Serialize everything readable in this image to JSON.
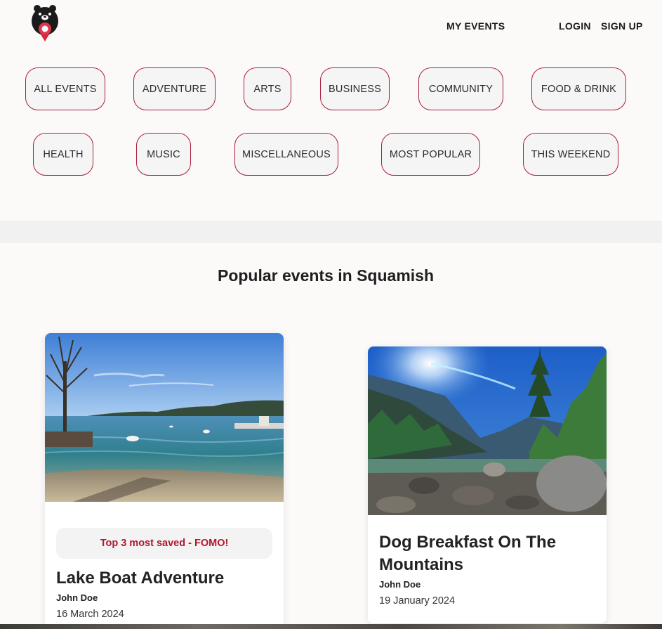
{
  "header": {
    "logo": "bear-logo",
    "nav": {
      "my_events": "MY EVENTS",
      "login": "LOGIN",
      "sign_up": "SIGN UP"
    }
  },
  "categories": [
    "ALL EVENTS",
    "ADVENTURE",
    "ARTS",
    "BUSINESS",
    "COMMUNITY",
    "FOOD & DRINK",
    "HEALTH",
    "MUSIC",
    "MISCELLANEOUS",
    "MOST POPULAR",
    "THIS WEEKEND"
  ],
  "section": {
    "title": "Popular events in Squamish"
  },
  "events": [
    {
      "badge": "Top 3 most saved - FOMO!",
      "title": "Lake Boat Adventure",
      "author": "John Doe",
      "date": "16 March 2024",
      "image": "lake-photo"
    },
    {
      "title": "Dog Breakfast On The Mountains",
      "author": "John Doe",
      "date": "19 January 2024",
      "image": "mountain-photo"
    }
  ],
  "colors": {
    "accent": "#a8203a",
    "badge_text": "#b0182f",
    "background": "#fcf9f9"
  }
}
